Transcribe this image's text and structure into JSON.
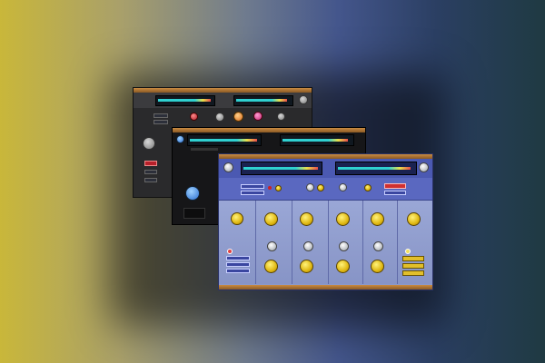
{
  "colors": {
    "accent_yellow": "#e0b812",
    "panel_blue": "#4b59b2",
    "meter_cyan": "#2fd0d0",
    "dark_panel": "#2a2a2c"
  },
  "icons": [
    "knob",
    "toggle",
    "meter",
    "lamp"
  ],
  "winA": {
    "buttons": [
      "",
      "",
      ""
    ]
  },
  "winB": {
    "labels": [
      "",
      "",
      "",
      "",
      "",
      ""
    ]
  },
  "winC": {
    "mid_left": [
      "",
      ""
    ],
    "mid_right": [
      "",
      ""
    ],
    "left_buttons": [
      "",
      "",
      ""
    ]
  }
}
